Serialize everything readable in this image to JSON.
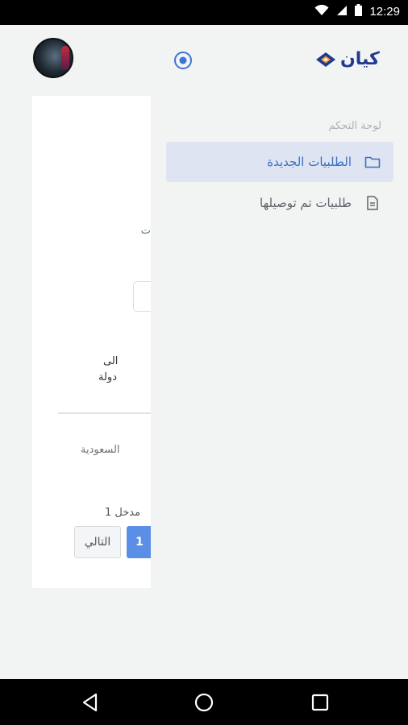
{
  "status_bar": {
    "time": "12:29",
    "icons": [
      "wifi-icon",
      "signal-icon",
      "battery-icon"
    ]
  },
  "header": {
    "logo_text": "كيان",
    "avatar_icon": "user-avatar",
    "action_icon": "target-icon"
  },
  "drawer": {
    "heading": "لوحة التحكم",
    "items": [
      {
        "label": "الطلبيات الجديدة",
        "icon": "folder-icon",
        "active": true
      },
      {
        "label": "طلبيات تم توصيلها",
        "icon": "document-icon",
        "active": false
      }
    ]
  },
  "background_card": {
    "label_fragment": "ت",
    "column_line1": "الى",
    "column_line2": "دولة",
    "cell_value": "السعودية",
    "entries_text": "1 مدخل",
    "next_button": "التالي",
    "page_button": "1"
  },
  "colors": {
    "accent": "#3d6fbf",
    "active_bg": "#dee4f1",
    "page_button": "#5b8ee6",
    "logo": "#1f3b8f"
  },
  "nav_bar": {
    "buttons": [
      "back-icon",
      "home-icon",
      "recents-icon"
    ]
  }
}
